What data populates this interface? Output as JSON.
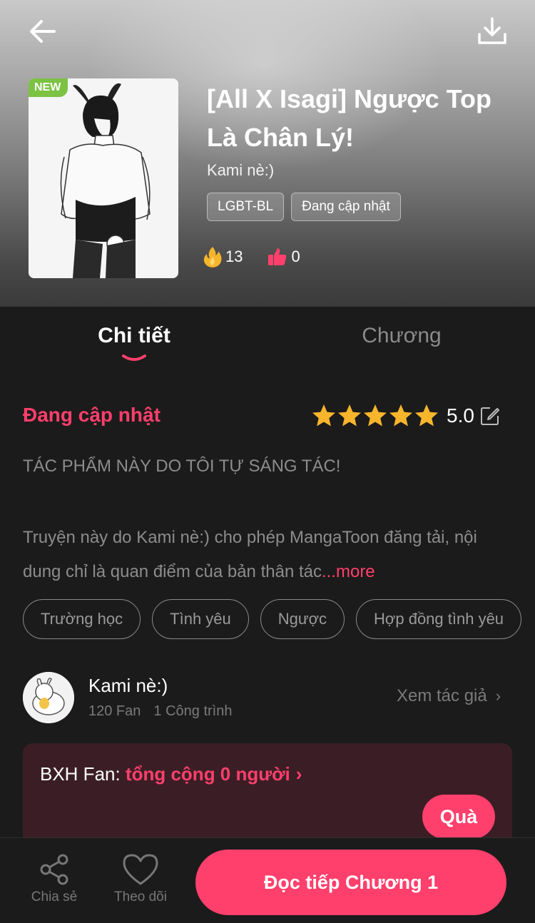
{
  "header": {
    "back_icon": "arrow-left-icon",
    "download_icon": "download-icon",
    "badge": "NEW",
    "title": "[All X Isagi] Ngược Top Là Chân Lý!",
    "author": "Kami nè:)",
    "tags": [
      "LGBT-BL",
      "Đang cập nhật"
    ],
    "stats": {
      "hot": "13",
      "likes": "0"
    }
  },
  "tabs": [
    {
      "label": "Chi tiết",
      "active": true
    },
    {
      "label": "Chương",
      "active": false
    }
  ],
  "detail": {
    "status": "Đang cập nhật",
    "rating": {
      "value": "5.0",
      "stars": 5
    },
    "description_line1": "TÁC PHẨM NÀY DO TÔI TỰ SÁNG TÁC!",
    "description_body": "Truyện này do Kami nè:) cho phép MangaToon đăng tải, nội dung chỉ là quan điểm của bản thân tác",
    "more_label": "...more",
    "topics": [
      "Trường học",
      "Tình yêu",
      "Ngược",
      "Hợp đồng tình yêu"
    ]
  },
  "author_row": {
    "name": "Kami nè:)",
    "fans": "120 Fan",
    "works": "1 Công trình",
    "view_label": "Xem tác giả",
    "view_chevron": "›"
  },
  "fan_rank": {
    "prefix": "BXH Fan: ",
    "highlight": "tổng cộng 0 người",
    "chevron": "›",
    "gift_label": "Quà"
  },
  "bottom_bar": {
    "share_label": "Chia sẻ",
    "follow_label": "Theo dõi",
    "read_label": "Đọc tiếp Chương 1"
  },
  "colors": {
    "accent": "#ff3f6c",
    "background": "#1b1b1b",
    "fan_card": "#3b1e25",
    "badge_green": "#7cc243",
    "star": "#f7b52c"
  }
}
